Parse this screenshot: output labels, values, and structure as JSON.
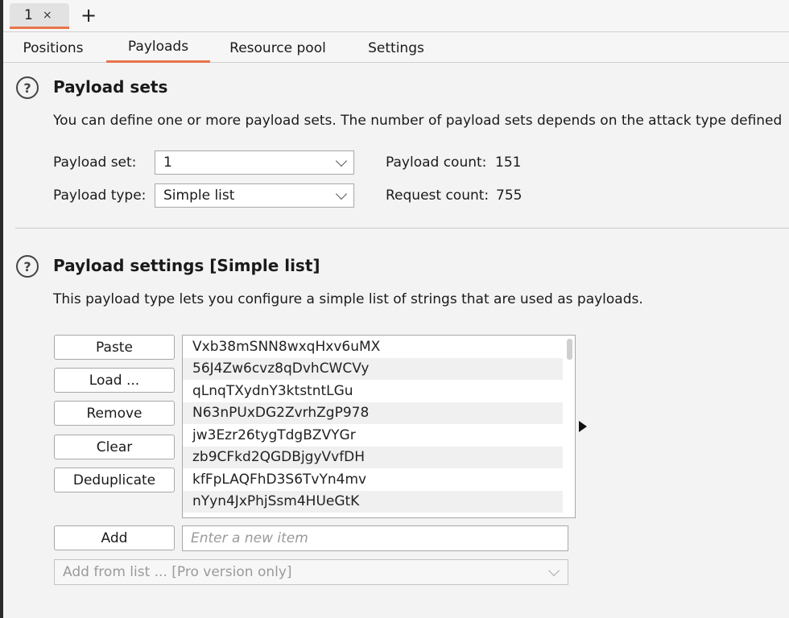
{
  "request_tab": {
    "label": "1",
    "close": "×",
    "new_tab": "+"
  },
  "subtabs": [
    {
      "label": "Positions"
    },
    {
      "label": "Payloads"
    },
    {
      "label": "Resource pool"
    },
    {
      "label": "Settings"
    }
  ],
  "payload_sets": {
    "help": "?",
    "title": "Payload sets",
    "description": "You can define one or more payload sets. The number of payload sets depends on the attack type defined",
    "set_label": "Payload set:",
    "set_value": "1",
    "type_label": "Payload type:",
    "type_value": "Simple list",
    "count_label": "Payload count:",
    "count_value": "151",
    "request_label": "Request count:",
    "request_value": "755"
  },
  "payload_settings": {
    "help": "?",
    "title": "Payload settings [Simple list]",
    "description": "This payload type lets you configure a simple list of strings that are used as payloads.",
    "buttons": {
      "paste": "Paste",
      "load": "Load ...",
      "remove": "Remove",
      "clear": "Clear",
      "deduplicate": "Deduplicate",
      "add": "Add"
    },
    "items": [
      "Vxb38mSNN8wxqHxv6uMX",
      "56J4Zw6cvz8qDvhCWCVy",
      "qLnqTXydnY3ktstntLGu",
      "N63nPUxDG2ZvrhZgP978",
      "jw3Ezr26tygTdgBZVYGr",
      "zb9CFkd2QGDBjgyVvfDH",
      "kfFpLAQFhD3S6TvYn4mv",
      "nYyn4JxPhjSsm4HUeGtK"
    ],
    "new_item_placeholder": "Enter a new item",
    "add_from_list": "Add from list ... [Pro version only]"
  }
}
